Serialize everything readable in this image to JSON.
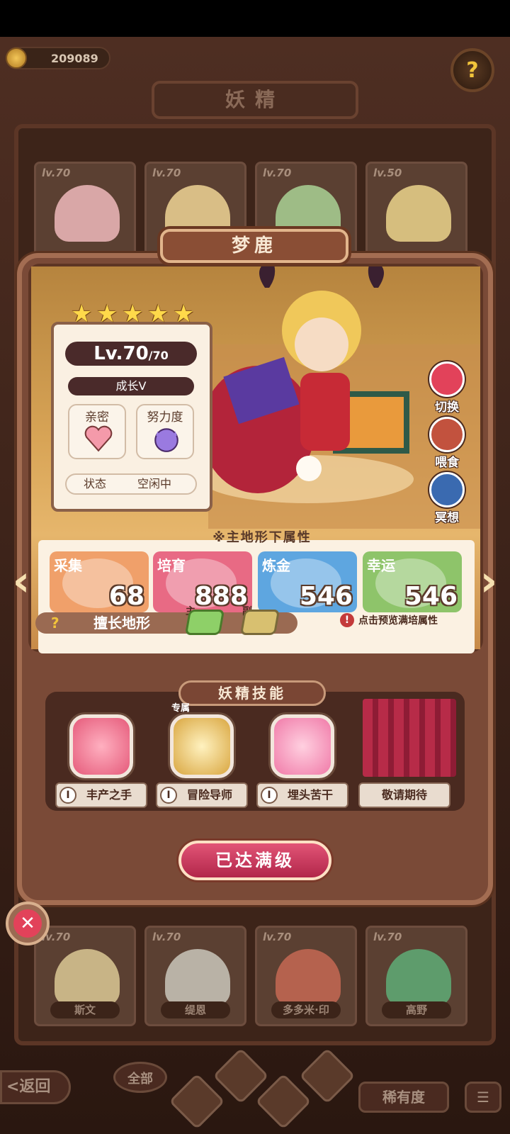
{
  "currency": {
    "amount": "209089"
  },
  "header": {
    "title": "妖精"
  },
  "background_cards": [
    {
      "level": "lv.70",
      "name": ""
    },
    {
      "level": "lv.70",
      "name": ""
    },
    {
      "level": "lv.70",
      "name": ""
    },
    {
      "level": "lv.50",
      "name": ""
    },
    {
      "level": "lv.70",
      "name": "斯文"
    },
    {
      "level": "lv.70",
      "name": "缇恩"
    },
    {
      "level": "lv.70",
      "name": "多多米·印"
    },
    {
      "level": "lv.70",
      "name": "高野"
    }
  ],
  "fairy": {
    "name": "梦鹿",
    "star_count": 5,
    "level": "Lv.70",
    "level_max": "/70",
    "growth": "成长V",
    "intimacy_label": "亲密",
    "effort_label": "努力度",
    "status_label": "状态",
    "status_value": "空闲中"
  },
  "side_buttons": {
    "switch": "切换",
    "feed": "喂食",
    "meditate": "冥想"
  },
  "attributes": {
    "heading": "※主地形下属性",
    "items": [
      {
        "label": "采集",
        "value": "68",
        "color": "#f0a06a"
      },
      {
        "label": "培育",
        "value": "888",
        "color": "#e86a84"
      },
      {
        "label": "炼金",
        "value": "546",
        "color": "#5ea6e0"
      },
      {
        "label": "幸运",
        "value": "546",
        "color": "#8ec46a"
      }
    ]
  },
  "terrain": {
    "label": "擅长地形",
    "main": "主",
    "sub": "副",
    "tip": "点击预览满培属性"
  },
  "skills": {
    "heading": "妖精技能",
    "exclusive_tag": "专属",
    "items": [
      {
        "num": "I",
        "name": "丰产之手"
      },
      {
        "num": "I",
        "name": "冒险导师"
      },
      {
        "num": "I",
        "name": "埋头苦干"
      }
    ],
    "coming_soon": "敬请期待"
  },
  "max_button": "已达满级",
  "bottom": {
    "back": "<返回",
    "all": "全部",
    "rarity": "稀有度",
    "menu": "☰"
  },
  "colors": {
    "accent": "#c33a3a",
    "panel": "#7a4a37"
  }
}
